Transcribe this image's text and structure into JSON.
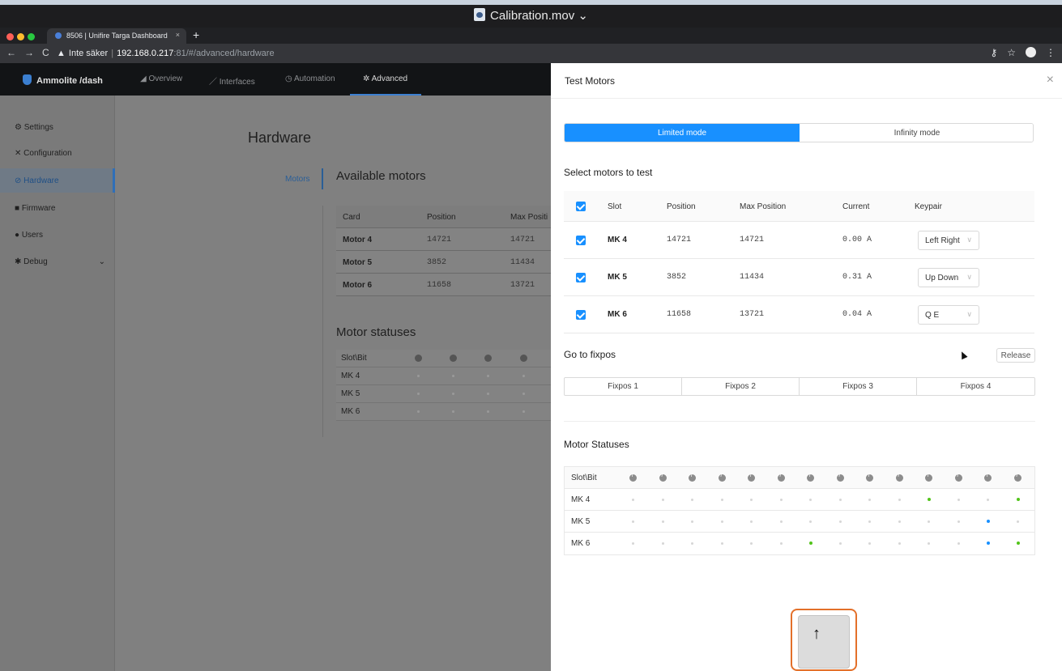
{
  "window": {
    "title": "Calibration.mov",
    "title_chevron": "⌄"
  },
  "browser": {
    "tab_title": "8506 | Unifire Targa Dashboard",
    "tab_close": "×",
    "new_tab": "+",
    "nav_icons": [
      "←",
      "→",
      "C"
    ],
    "security_label": "Inte säker",
    "url_host": "192.168.0.217",
    "url_path": ":81/#/advanced/hardware",
    "right_icons": [
      "key-icon",
      "star-icon",
      "profile-icon",
      "menu-icon"
    ]
  },
  "app": {
    "brand": "Ammolite /dash",
    "top_nav": [
      {
        "label": "Overview",
        "icon": "chart-icon"
      },
      {
        "label": "Interfaces",
        "icon": "pen-icon"
      },
      {
        "label": "Automation",
        "icon": "clock-icon"
      },
      {
        "label": "Advanced",
        "icon": "gear-icon"
      }
    ],
    "sidebar": [
      {
        "label": "Settings",
        "icon": "⚙"
      },
      {
        "label": "Configuration",
        "icon": "✕"
      },
      {
        "label": "Hardware",
        "icon": "⊘"
      },
      {
        "label": "Firmware",
        "icon": "■"
      },
      {
        "label": "Users",
        "icon": "●"
      },
      {
        "label": "Debug",
        "icon": "✱",
        "chevron": "⌄"
      }
    ],
    "page_title": "Hardware",
    "sub_nav": "Motors",
    "available_title": "Available motors",
    "bg_table": {
      "headers": [
        "Card",
        "Position",
        "Max Positi"
      ],
      "rows": [
        [
          "Motor 4",
          "14721",
          "14721"
        ],
        [
          "Motor 5",
          "3852",
          "11434"
        ],
        [
          "Motor 6",
          "11658",
          "13721"
        ]
      ]
    },
    "bg_statuses_title": "Motor statuses",
    "bg_status_rows": [
      "Slot\\Bit",
      "MK 4",
      "MK 5",
      "MK 6"
    ]
  },
  "drawer": {
    "title": "Test Motors",
    "close": "×",
    "modes": [
      "Limited mode",
      "Infinity mode"
    ],
    "select_label": "Select motors to test",
    "table": {
      "headers": [
        "Slot",
        "Position",
        "Max Position",
        "Current",
        "Keypair"
      ],
      "rows": [
        {
          "slot": "MK 4",
          "position": "14721",
          "max_position": "14721",
          "current": "0.00 A",
          "keypair": "Left Right"
        },
        {
          "slot": "MK 5",
          "position": "3852",
          "max_position": "11434",
          "current": "0.31 A",
          "keypair": "Up Down"
        },
        {
          "slot": "MK 6",
          "position": "11658",
          "max_position": "13721",
          "current": "0.04 A",
          "keypair": "Q E"
        }
      ]
    },
    "fixpos_label": "Go to fixpos",
    "release": "Release",
    "fixpos_buttons": [
      "Fixpos 1",
      "Fixpos 2",
      "Fixpos 3",
      "Fixpos 4"
    ],
    "statuses_title": "Motor Statuses",
    "status_table": {
      "header": "Slot\\Bit",
      "bits": 14,
      "rows": [
        {
          "label": "MK 4",
          "on": {
            "10": "green",
            "13": "green"
          }
        },
        {
          "label": "MK 5",
          "on": {
            "12": "blue"
          }
        },
        {
          "label": "MK 6",
          "on": {
            "6": "green",
            "12": "blue",
            "13": "green"
          }
        }
      ]
    },
    "colors": {
      "primary": "#1890ff",
      "green": "#52c41a",
      "blue": "#1890ff"
    }
  },
  "overlay": {
    "key": "↑",
    "key_name": "up-arrow-key"
  }
}
